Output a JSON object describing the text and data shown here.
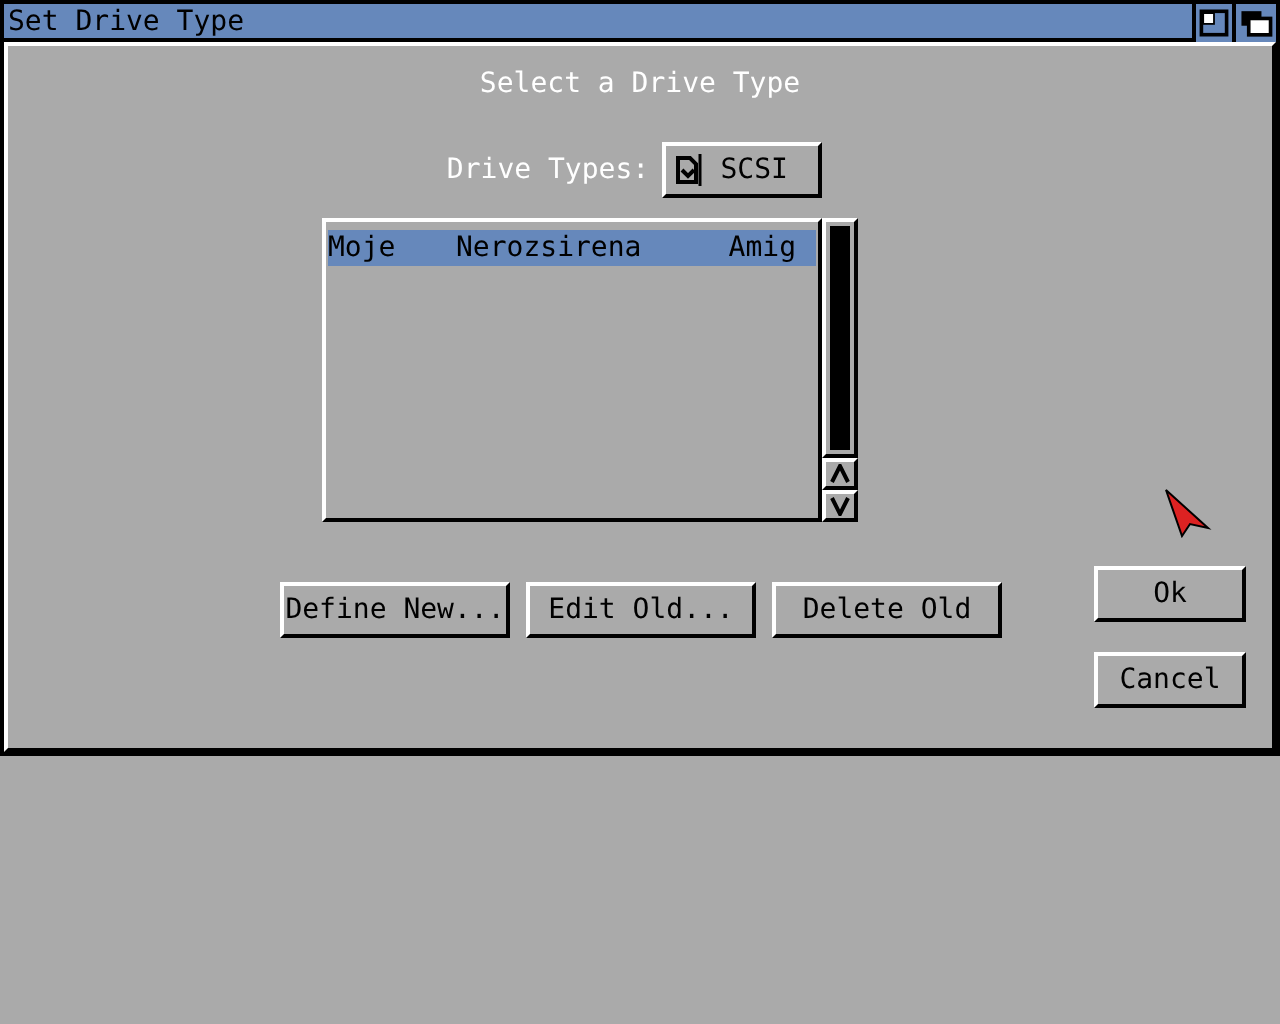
{
  "window": {
    "title": "Set Drive Type"
  },
  "heading": "Select a Drive Type",
  "drive_types": {
    "label": "Drive Types:",
    "value": "SCSI"
  },
  "list": {
    "rows": [
      {
        "cells": [
          "Moje",
          "Nerozsirena",
          "Amig"
        ],
        "selected": true
      }
    ]
  },
  "actions": [
    "Define New...",
    "Edit Old...",
    "Delete Old"
  ],
  "buttons": [
    "Ok",
    "Cancel"
  ]
}
